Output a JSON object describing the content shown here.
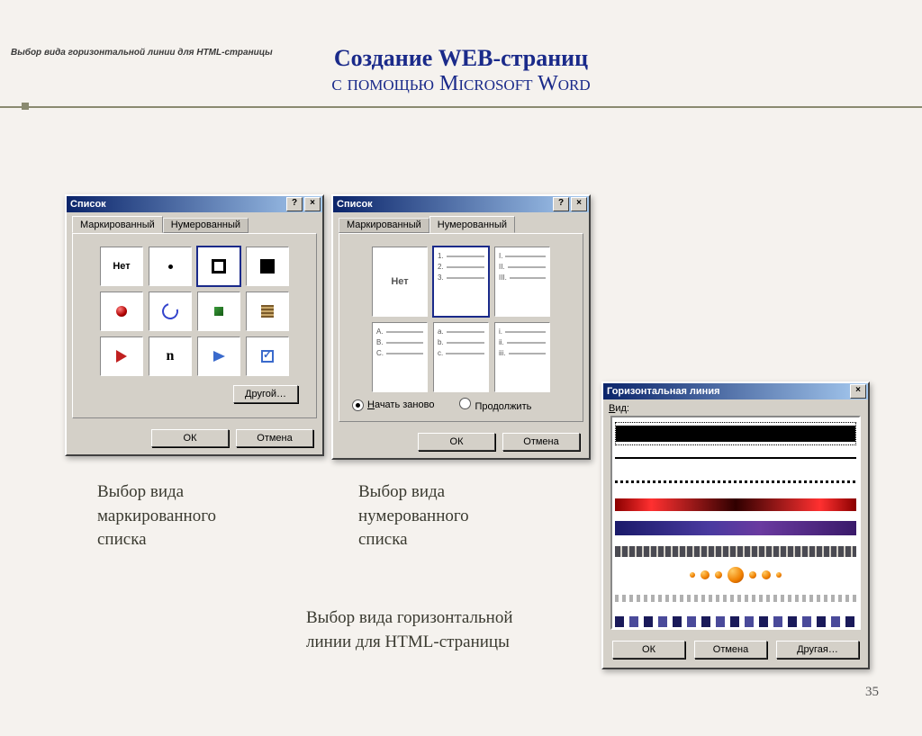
{
  "top_caption": "Выбор вида горизонтальной линии для HTML-страницы",
  "heading": {
    "line1": "Создание WEB-страниц",
    "line2": "с помощью Microsoft Word"
  },
  "page_number": "35",
  "dialog_bulleted": {
    "title": "Список",
    "tabs": [
      "Маркированный",
      "Нумерованный"
    ],
    "none_label": "Нет",
    "other_button": "Другой…",
    "ok": "ОК",
    "cancel": "Отмена",
    "caption": "Выбор вида маркированного списка"
  },
  "dialog_numbered": {
    "title": "Список",
    "tabs": [
      "Маркированный",
      "Нумерованный"
    ],
    "none_label": "Нет",
    "options": {
      "n1": [
        "1.",
        "2.",
        "3."
      ],
      "n2": [
        "I.",
        "II.",
        "III."
      ],
      "n3": [
        "A.",
        "B.",
        "C."
      ],
      "n4": [
        "a.",
        "b.",
        "c."
      ],
      "n5": [
        "i.",
        "ii.",
        "iii."
      ]
    },
    "radios": {
      "restart": "Начать заново",
      "continue": "Продолжить"
    },
    "ok": "ОК",
    "cancel": "Отмена",
    "caption": "Выбор вида нумерованного списка"
  },
  "dialog_hr": {
    "title": "Горизонтальная линия",
    "field_label": "Вид:",
    "ok": "ОК",
    "cancel": "Отмена",
    "other": "Другая…",
    "caption": "Выбор вида горизонтальной линии для HTML-страницы"
  }
}
